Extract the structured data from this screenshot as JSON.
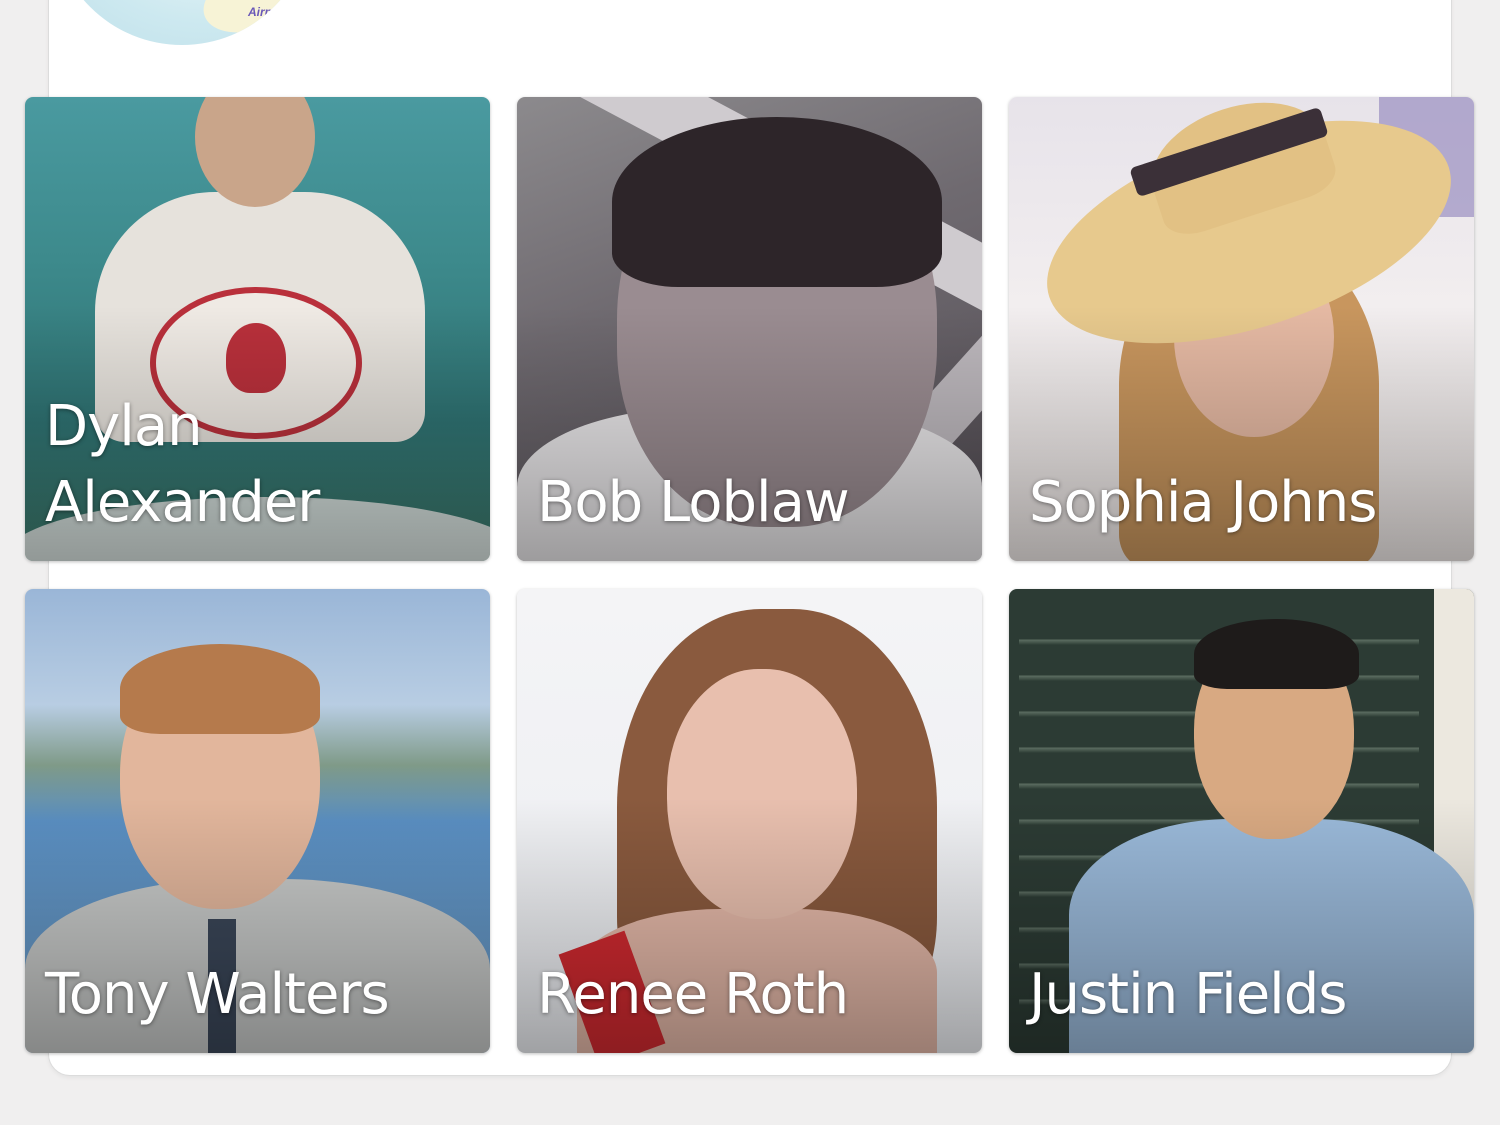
{
  "map": {
    "label": "Airport"
  },
  "people": [
    {
      "name": "Dylan Alexander"
    },
    {
      "name": "Bob Loblaw"
    },
    {
      "name": "Sophia Johns"
    },
    {
      "name": "Tony Walters"
    },
    {
      "name": "Renee Roth"
    },
    {
      "name": "Justin Fields"
    }
  ]
}
